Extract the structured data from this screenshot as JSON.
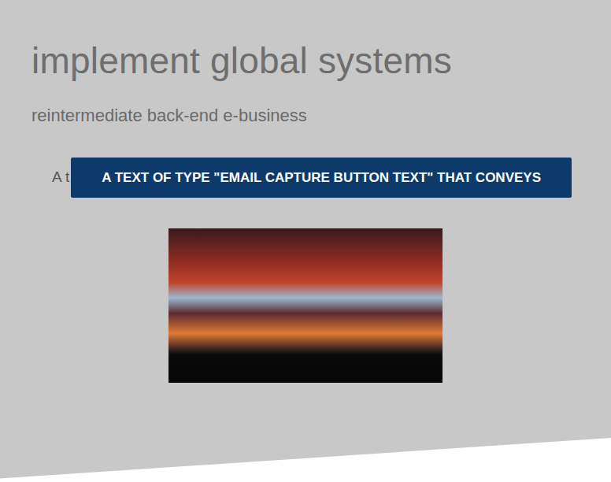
{
  "hero": {
    "title": "implement global systems",
    "subtitle": "reintermediate back-end e-business"
  },
  "cta": {
    "teaser": "A t",
    "button": "A TEXT OF TYPE \"EMAIL CAPTURE BUTTON TEXT\" THAT CONVEYS"
  }
}
